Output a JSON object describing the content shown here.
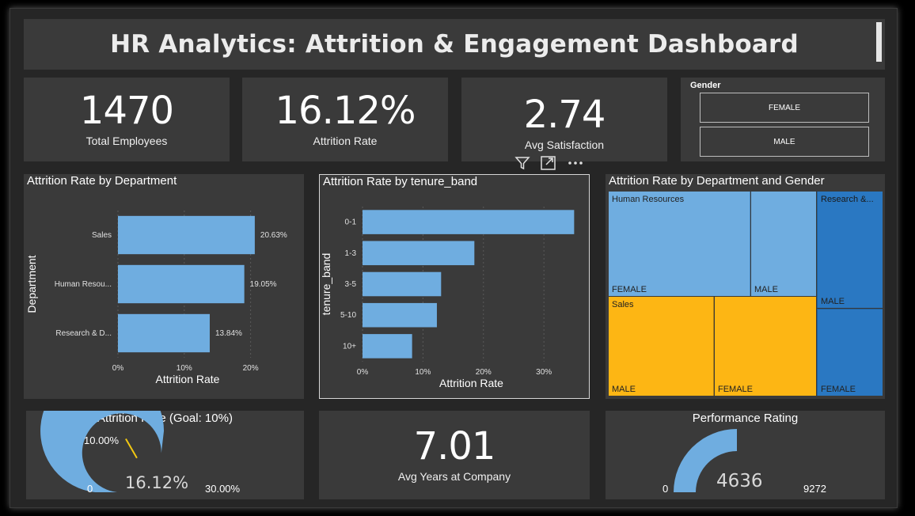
{
  "title": "HR Analytics: Attrition & Engagement Dashboard",
  "kpis": {
    "total_employees": {
      "value": "1470",
      "label": "Total Employees"
    },
    "attrition_rate": {
      "value": "16.12%",
      "label": "Attrition Rate"
    },
    "avg_satisfaction": {
      "value": "2.74",
      "label": "Avg Satisfaction"
    },
    "avg_years": {
      "value": "7.01",
      "label": "Avg Years at Company"
    }
  },
  "slicer": {
    "title": "Gender",
    "options": [
      "FEMALE",
      "MALE"
    ]
  },
  "charts": {
    "dept": {
      "title": "Attrition Rate by Department"
    },
    "tenure": {
      "title": "Attrition Rate by tenure_band"
    },
    "treemap": {
      "title": "Attrition Rate by Department and Gender"
    }
  },
  "chart_data": [
    {
      "type": "bar",
      "title": "Attrition Rate by Department",
      "xlabel": "Attrition Rate",
      "ylabel": "Department",
      "categories": [
        "Sales",
        "Human Resou...",
        "Research & D..."
      ],
      "values": [
        20.63,
        19.05,
        13.84
      ],
      "data_labels": [
        "20.63%",
        "19.05%",
        "13.84%"
      ],
      "xticks": [
        "0%",
        "10%",
        "20%"
      ],
      "xlim": [
        0,
        21
      ],
      "color": "#6fade0"
    },
    {
      "type": "bar",
      "title": "Attrition Rate by tenure_band",
      "xlabel": "Attrition Rate",
      "ylabel": "tenure_band",
      "categories": [
        "0-1",
        "1-3",
        "3-5",
        "5-10",
        "10+"
      ],
      "values": [
        35.0,
        18.5,
        13.0,
        12.3,
        8.2
      ],
      "xticks": [
        "0%",
        "10%",
        "20%",
        "30%"
      ],
      "xlim": [
        0,
        36
      ],
      "color": "#6fade0"
    },
    {
      "type": "treemap",
      "title": "Attrition Rate by Department and Gender",
      "groups": [
        {
          "name": "Human Resources",
          "color": "#6fade0",
          "children": [
            {
              "name": "FEMALE"
            },
            {
              "name": "MALE"
            }
          ]
        },
        {
          "name": "Sales",
          "color": "#fdb614",
          "children": [
            {
              "name": "MALE"
            },
            {
              "name": "FEMALE"
            }
          ]
        },
        {
          "name": "Research &...",
          "color": "#2a78c2",
          "children": [
            {
              "name": "MALE"
            },
            {
              "name": "FEMALE"
            }
          ]
        }
      ]
    }
  ],
  "gauges": {
    "attrition": {
      "title": "Attrition Rate (Goal: 10%)",
      "min": "0",
      "max": "30.00%",
      "target": "10.00%",
      "value": "16.12%",
      "fill_fraction": 0.537,
      "target_fraction": 0.333
    },
    "performance": {
      "title": "Performance Rating",
      "min": "0",
      "max": "9272",
      "value": "4636",
      "fill_fraction": 0.5
    }
  },
  "colors": {
    "bar": "#6fade0",
    "gauge_fill": "#6fade0",
    "gauge_target": "#f2c811"
  }
}
